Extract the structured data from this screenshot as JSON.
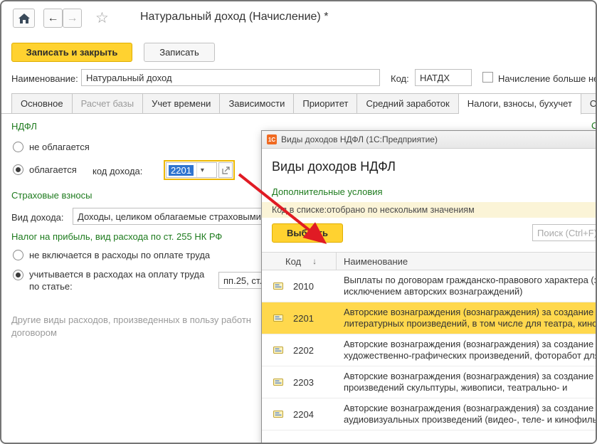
{
  "window": {
    "title": "Натуральный доход (Начисление) *"
  },
  "icons": {
    "back": "←",
    "forward": "→",
    "star": "☆",
    "dropdown": "▾",
    "app_logo": "1С"
  },
  "commands": {
    "save_close": "Записать и закрыть",
    "save": "Записать"
  },
  "fields": {
    "name_label": "Наименование:",
    "name_value": "Натуральный доход",
    "code_label": "Код:",
    "code_value": "НАТДХ",
    "flag_label": "Начисление больше не"
  },
  "tabs": [
    {
      "label": "Основное"
    },
    {
      "label": "Расчет базы"
    },
    {
      "label": "Учет времени"
    },
    {
      "label": "Зависимости"
    },
    {
      "label": "Приоритет"
    },
    {
      "label": "Средний заработок"
    },
    {
      "label": "Налоги, взносы, бухучет"
    },
    {
      "label": "Описание"
    }
  ],
  "form": {
    "ndfl_header": "НДФЛ",
    "radio_not_taxed": "не облагается",
    "radio_taxed": "облагается",
    "income_code_label": "код дохода:",
    "income_code_value": "2201",
    "insurance_header": "Страховые взносы",
    "income_type_label": "Вид дохода:",
    "income_type_value": "Доходы, целиком облагаемые страховыми взносами",
    "profit_header": "Налог на прибыль, вид расхода по ст. 255 НК РФ",
    "radio_not_included": "не включается в расходы по оплате труда",
    "radio_included": "учитывается в расходах на оплату труда по статье:",
    "article_value": "пп.25, ст.",
    "note_line1": "Другие виды расходов, произведенных в пользу работн",
    "note_line2": "договором",
    "right_link": "С"
  },
  "popup": {
    "titlebar": "Виды доходов НДФЛ (1С:Предприятие)",
    "title": "Виды доходов НДФЛ",
    "link": "Дополнительные условия",
    "info": "Код в списке:отобрано по нескольким значениям",
    "select_button": "Выбрать",
    "search_placeholder": "Поиск (Ctrl+F)",
    "columns": {
      "code": "Код",
      "sort": "↓",
      "name": "Наименование"
    },
    "rows": [
      {
        "code": "2010",
        "line1": "Выплаты по договорам гражданско-правового характера (за",
        "line2": "исключением авторских вознаграждений)",
        "selected": false
      },
      {
        "code": "2201",
        "line1": "Авторские вознаграждения (вознаграждения) за создание",
        "line2": "литературных произведений, в том числе для театра, кино,",
        "selected": true
      },
      {
        "code": "2202",
        "line1": "Авторские вознаграждения (вознаграждения) за создание",
        "line2": "художественно-графических произведений, фоторабот для",
        "selected": false
      },
      {
        "code": "2203",
        "line1": "Авторские вознаграждения (вознаграждения) за создание",
        "line2": "произведений скульптуры, живописи, театрально- и",
        "selected": false
      },
      {
        "code": "2204",
        "line1": "Авторские вознаграждения (вознаграждения) за создание",
        "line2": "аудиовизуальных произведений (видео-, теле- и кинофильмов)",
        "selected": false
      }
    ]
  },
  "colors": {
    "accent_yellow": "#FFD230",
    "green_link": "#1E7B1E",
    "selection_blue": "#2F74D0",
    "highlight_row": "#FFD84D",
    "info_bar": "#FBF4D7",
    "arrow_red": "#E01B24"
  }
}
